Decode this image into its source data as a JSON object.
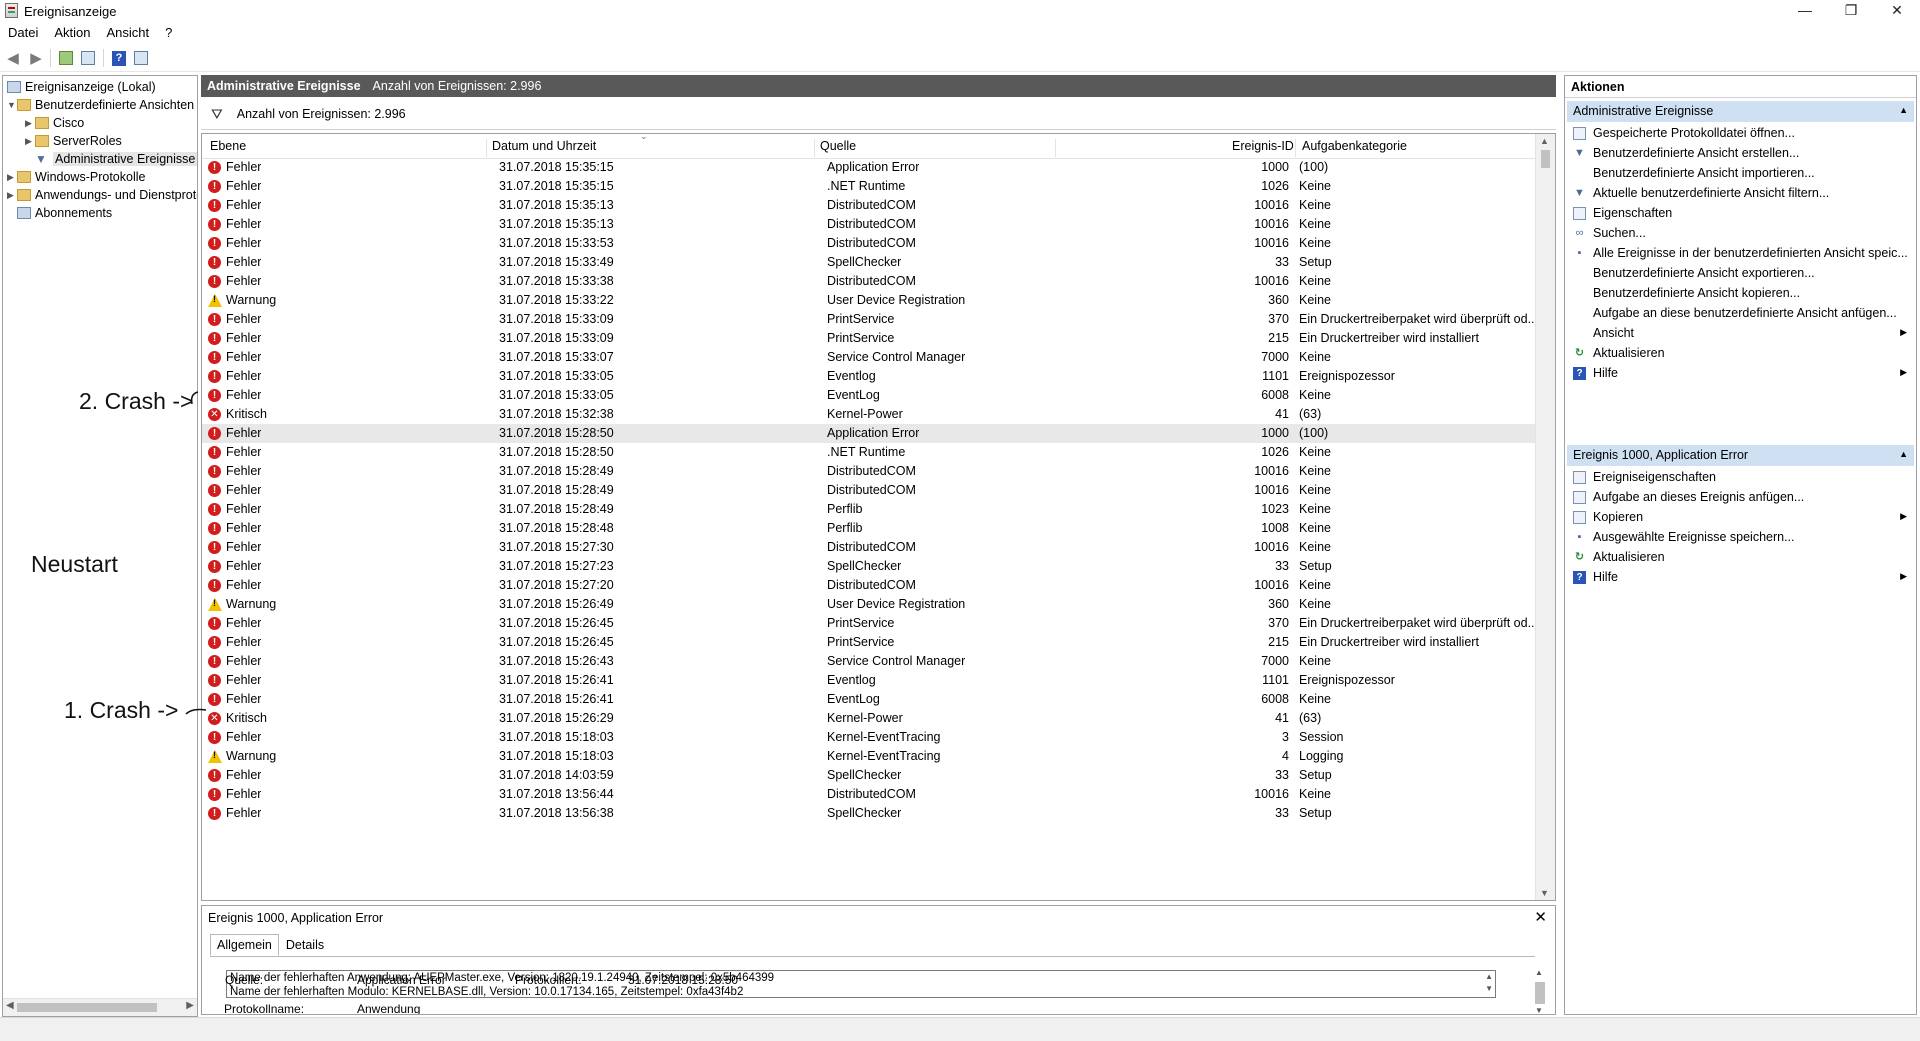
{
  "window": {
    "title": "Ereignisanzeige",
    "controls": [
      "—",
      "❐",
      "✕"
    ]
  },
  "menu": [
    "Datei",
    "Aktion",
    "Ansicht",
    "?"
  ],
  "tree": {
    "root": "Ereignisanzeige (Lokal)",
    "custom_views": "Benutzerdefinierte Ansichten",
    "cisco": "Cisco",
    "server_roles": "ServerRoles",
    "admin_events": "Administrative Ereignisse",
    "windows_logs": "Windows-Protokolle",
    "app_service_logs": "Anwendungs- und Dienstprotokolle",
    "subscriptions": "Abonnements"
  },
  "center": {
    "header_title": "Administrative Ereignisse",
    "header_count": "Anzahl von Ereignissen: 2.996",
    "filter_text": "Anzahl von Ereignissen: 2.996",
    "columns": [
      "Ebene",
      "Datum und Uhrzeit",
      "Quelle",
      "Ereignis-ID",
      "Aufgabenkategorie"
    ],
    "rows": [
      {
        "level": "Fehler",
        "icon": "error",
        "date": "31.07.2018 15:35:15",
        "source": "Application Error",
        "id": "1000",
        "task": "(100)"
      },
      {
        "level": "Fehler",
        "icon": "error",
        "date": "31.07.2018 15:35:15",
        "source": ".NET Runtime",
        "id": "1026",
        "task": "Keine"
      },
      {
        "level": "Fehler",
        "icon": "error",
        "date": "31.07.2018 15:35:13",
        "source": "DistributedCOM",
        "id": "10016",
        "task": "Keine"
      },
      {
        "level": "Fehler",
        "icon": "error",
        "date": "31.07.2018 15:35:13",
        "source": "DistributedCOM",
        "id": "10016",
        "task": "Keine"
      },
      {
        "level": "Fehler",
        "icon": "error",
        "date": "31.07.2018 15:33:53",
        "source": "DistributedCOM",
        "id": "10016",
        "task": "Keine"
      },
      {
        "level": "Fehler",
        "icon": "error",
        "date": "31.07.2018 15:33:49",
        "source": "SpellChecker",
        "id": "33",
        "task": "Setup"
      },
      {
        "level": "Fehler",
        "icon": "error",
        "date": "31.07.2018 15:33:38",
        "source": "DistributedCOM",
        "id": "10016",
        "task": "Keine"
      },
      {
        "level": "Warnung",
        "icon": "warning",
        "date": "31.07.2018 15:33:22",
        "source": "User Device Registration",
        "id": "360",
        "task": "Keine"
      },
      {
        "level": "Fehler",
        "icon": "error",
        "date": "31.07.2018 15:33:09",
        "source": "PrintService",
        "id": "370",
        "task": "Ein Druckertreiberpaket wird überprüft od..."
      },
      {
        "level": "Fehler",
        "icon": "error",
        "date": "31.07.2018 15:33:09",
        "source": "PrintService",
        "id": "215",
        "task": "Ein Druckertreiber wird installiert"
      },
      {
        "level": "Fehler",
        "icon": "error",
        "date": "31.07.2018 15:33:07",
        "source": "Service Control Manager",
        "id": "7000",
        "task": "Keine"
      },
      {
        "level": "Fehler",
        "icon": "error",
        "date": "31.07.2018 15:33:05",
        "source": "Eventlog",
        "id": "1101",
        "task": "Ereignispozessor"
      },
      {
        "level": "Fehler",
        "icon": "error",
        "date": "31.07.2018 15:33:05",
        "source": "EventLog",
        "id": "6008",
        "task": "Keine"
      },
      {
        "level": "Kritisch",
        "icon": "critical",
        "date": "31.07.2018 15:32:38",
        "source": "Kernel-Power",
        "id": "41",
        "task": "(63)"
      },
      {
        "level": "Fehler",
        "icon": "error",
        "date": "31.07.2018 15:28:50",
        "source": "Application Error",
        "id": "1000",
        "task": "(100)",
        "selected": true
      },
      {
        "level": "Fehler",
        "icon": "error",
        "date": "31.07.2018 15:28:50",
        "source": ".NET Runtime",
        "id": "1026",
        "task": "Keine"
      },
      {
        "level": "Fehler",
        "icon": "error",
        "date": "31.07.2018 15:28:49",
        "source": "DistributedCOM",
        "id": "10016",
        "task": "Keine"
      },
      {
        "level": "Fehler",
        "icon": "error",
        "date": "31.07.2018 15:28:49",
        "source": "DistributedCOM",
        "id": "10016",
        "task": "Keine"
      },
      {
        "level": "Fehler",
        "icon": "error",
        "date": "31.07.2018 15:28:49",
        "source": "Perflib",
        "id": "1023",
        "task": "Keine"
      },
      {
        "level": "Fehler",
        "icon": "error",
        "date": "31.07.2018 15:28:48",
        "source": "Perflib",
        "id": "1008",
        "task": "Keine"
      },
      {
        "level": "Fehler",
        "icon": "error",
        "date": "31.07.2018 15:27:30",
        "source": "DistributedCOM",
        "id": "10016",
        "task": "Keine"
      },
      {
        "level": "Fehler",
        "icon": "error",
        "date": "31.07.2018 15:27:23",
        "source": "SpellChecker",
        "id": "33",
        "task": "Setup"
      },
      {
        "level": "Fehler",
        "icon": "error",
        "date": "31.07.2018 15:27:20",
        "source": "DistributedCOM",
        "id": "10016",
        "task": "Keine"
      },
      {
        "level": "Warnung",
        "icon": "warning",
        "date": "31.07.2018 15:26:49",
        "source": "User Device Registration",
        "id": "360",
        "task": "Keine"
      },
      {
        "level": "Fehler",
        "icon": "error",
        "date": "31.07.2018 15:26:45",
        "source": "PrintService",
        "id": "370",
        "task": "Ein Druckertreiberpaket wird überprüft od..."
      },
      {
        "level": "Fehler",
        "icon": "error",
        "date": "31.07.2018 15:26:45",
        "source": "PrintService",
        "id": "215",
        "task": "Ein Druckertreiber wird installiert"
      },
      {
        "level": "Fehler",
        "icon": "error",
        "date": "31.07.2018 15:26:43",
        "source": "Service Control Manager",
        "id": "7000",
        "task": "Keine"
      },
      {
        "level": "Fehler",
        "icon": "error",
        "date": "31.07.2018 15:26:41",
        "source": "Eventlog",
        "id": "1101",
        "task": "Ereignispozessor"
      },
      {
        "level": "Fehler",
        "icon": "error",
        "date": "31.07.2018 15:26:41",
        "source": "EventLog",
        "id": "6008",
        "task": "Keine"
      },
      {
        "level": "Kritisch",
        "icon": "critical",
        "date": "31.07.2018 15:26:29",
        "source": "Kernel-Power",
        "id": "41",
        "task": "(63)"
      },
      {
        "level": "Fehler",
        "icon": "error",
        "date": "31.07.2018 15:18:03",
        "source": "Kernel-EventTracing",
        "id": "3",
        "task": "Session"
      },
      {
        "level": "Warnung",
        "icon": "warning",
        "date": "31.07.2018 15:18:03",
        "source": "Kernel-EventTracing",
        "id": "4",
        "task": "Logging"
      },
      {
        "level": "Fehler",
        "icon": "error",
        "date": "31.07.2018 14:03:59",
        "source": "SpellChecker",
        "id": "33",
        "task": "Setup"
      },
      {
        "level": "Fehler",
        "icon": "error",
        "date": "31.07.2018 13:56:44",
        "source": "DistributedCOM",
        "id": "10016",
        "task": "Keine"
      },
      {
        "level": "Fehler",
        "icon": "error",
        "date": "31.07.2018 13:56:38",
        "source": "SpellChecker",
        "id": "33",
        "task": "Setup"
      }
    ]
  },
  "detail": {
    "title": "Ereignis 1000, Application Error",
    "close": "✕",
    "tabs": [
      "Allgemein",
      "Details"
    ],
    "message_line1": "Name der fehlerhaften Anwendung: AUEPMaster.exe, Version: 1820.19.1.24940, Zeitstempel: 0x5b464399",
    "message_line2": "Name der fehlerhaften Modulo: KERNELBASE.dll, Version: 10.0.17134.165, Zeitstempel: 0xfa43f4b2",
    "log_name_label": "Protokollname:",
    "log_name_value": "Anwendung",
    "source_label": "Quelle:",
    "source_value": "Application Error",
    "logged_label": "Protokolliert:",
    "logged_value": "31.07.2018 15:28:50"
  },
  "actions": {
    "title": "Aktionen",
    "section1": "Administrative Ereignisse",
    "section1_items": [
      {
        "label": "Gespeicherte Protokolldatei öffnen...",
        "icon": "open-log-icon"
      },
      {
        "label": "Benutzerdefinierte Ansicht erstellen...",
        "icon": "filter-icon"
      },
      {
        "label": "Benutzerdefinierte Ansicht importieren...",
        "icon": "none"
      },
      {
        "label": "Aktuelle benutzerdefinierte Ansicht filtern...",
        "icon": "filter-icon"
      },
      {
        "label": "Eigenschaften",
        "icon": "properties-icon"
      },
      {
        "label": "Suchen...",
        "icon": "binoculars-icon"
      },
      {
        "label": "Alle Ereignisse in der benutzerdefinierten Ansicht speic...",
        "icon": "save-icon"
      },
      {
        "label": "Benutzerdefinierte Ansicht exportieren...",
        "icon": "none"
      },
      {
        "label": "Benutzerdefinierte Ansicht kopieren...",
        "icon": "none"
      },
      {
        "label": "Aufgabe an diese benutzerdefinierte Ansicht anfügen...",
        "icon": "none"
      },
      {
        "label": "Ansicht",
        "icon": "none",
        "submenu": true
      },
      {
        "label": "Aktualisieren",
        "icon": "refresh-icon"
      },
      {
        "label": "Hilfe",
        "icon": "help-icon",
        "submenu": true
      }
    ],
    "section2": "Ereignis 1000, Application Error",
    "section2_items": [
      {
        "label": "Ereigniseigenschaften",
        "icon": "properties-icon"
      },
      {
        "label": "Aufgabe an dieses Ereignis anfügen...",
        "icon": "task-icon"
      },
      {
        "label": "Kopieren",
        "icon": "copy-icon",
        "submenu": true
      },
      {
        "label": "Ausgewählte Ereignisse speichern...",
        "icon": "save-icon"
      },
      {
        "label": "Aktualisieren",
        "icon": "refresh-icon"
      },
      {
        "label": "Hilfe",
        "icon": "help-icon",
        "submenu": true
      }
    ]
  },
  "annotations": {
    "crash2": "2. Crash ->",
    "restart": "Neustart",
    "crash1": "1. Crash ->"
  }
}
